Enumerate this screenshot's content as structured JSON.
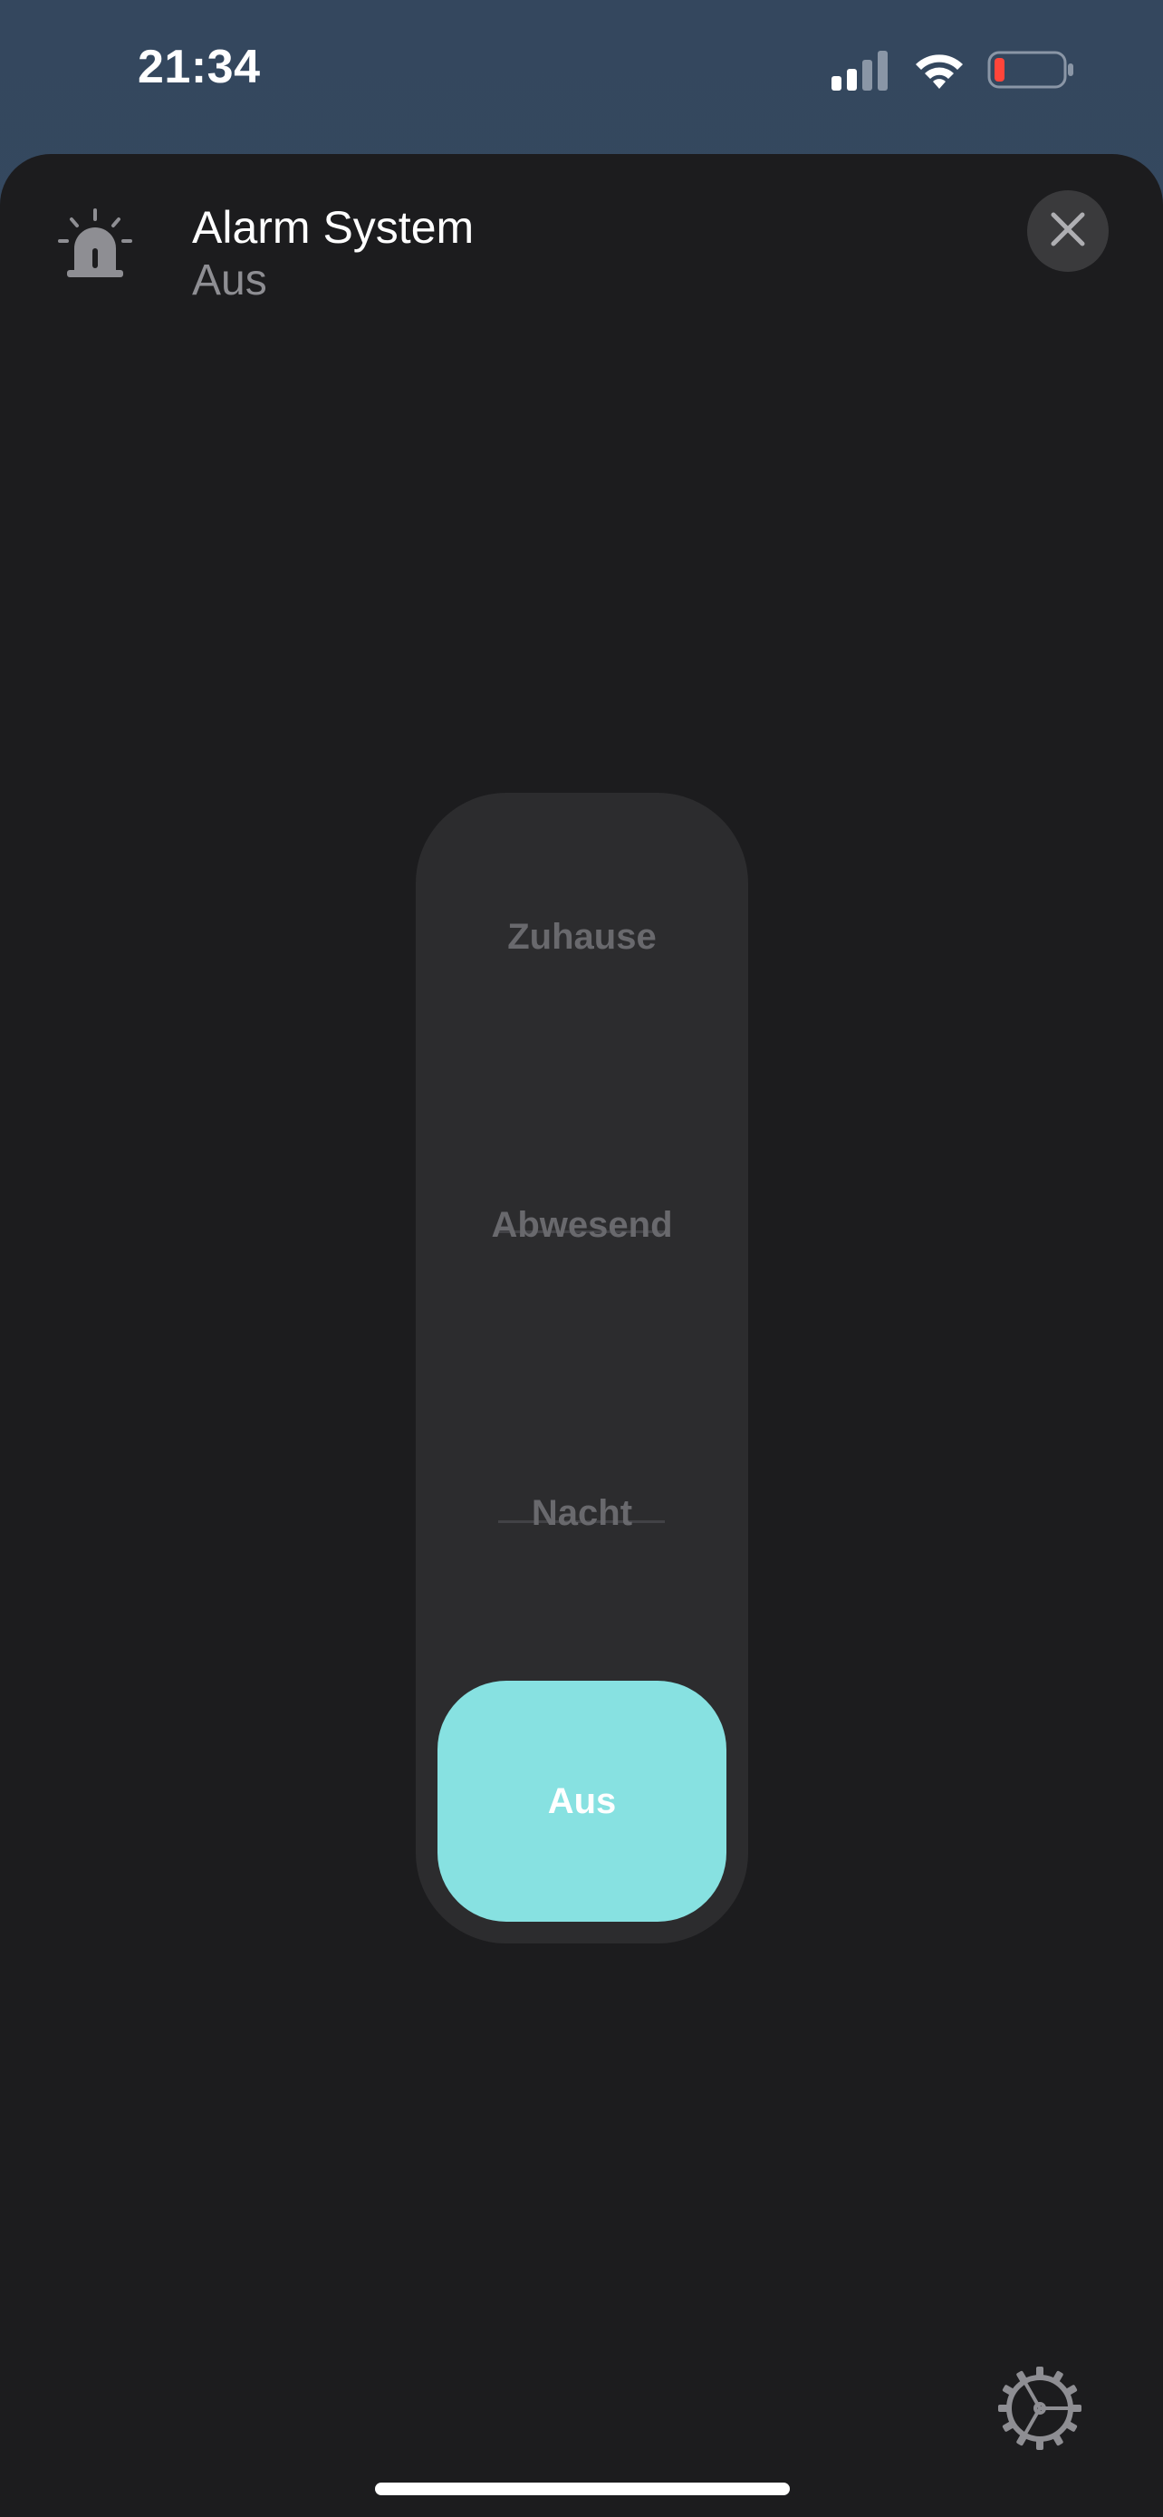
{
  "status_bar": {
    "time": "21:34",
    "signal_icon": "cellular-signal-icon",
    "wifi_icon": "wifi-icon",
    "battery_icon": "battery-low-icon",
    "battery_color": "#ff453a"
  },
  "header": {
    "icon": "alarm-siren-icon",
    "title": "Alarm System",
    "subtitle": "Aus",
    "close_icon": "close-icon"
  },
  "mode_selector": {
    "options": [
      {
        "label": "Zuhause",
        "selected": false
      },
      {
        "label": "Abwesend",
        "selected": false
      },
      {
        "label": "Nacht",
        "selected": false
      },
      {
        "label": "Aus",
        "selected": true
      }
    ],
    "selected_color": "#87e1e1"
  },
  "footer": {
    "settings_icon": "gear-icon"
  }
}
